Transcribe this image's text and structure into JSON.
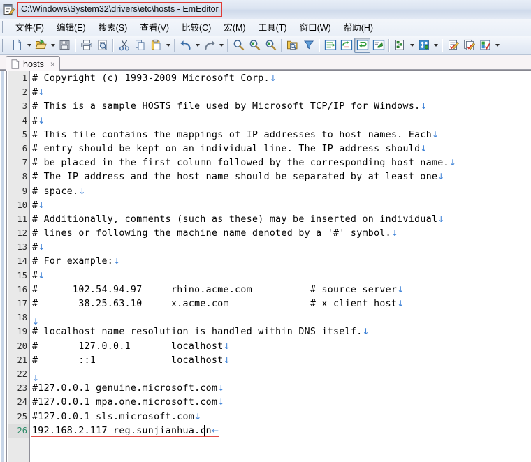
{
  "window": {
    "title": "C:\\Windows\\System32\\drivers\\etc\\hosts - EmEditor",
    "title_highlight_color": "#e03a34",
    "app_icon": "emeditor-document-pencil-icon"
  },
  "menu": {
    "items": [
      {
        "label": "文件(F)",
        "name": "menu-file"
      },
      {
        "label": "编辑(E)",
        "name": "menu-edit"
      },
      {
        "label": "搜索(S)",
        "name": "menu-search"
      },
      {
        "label": "查看(V)",
        "name": "menu-view"
      },
      {
        "label": "比较(C)",
        "name": "menu-compare"
      },
      {
        "label": "宏(M)",
        "name": "menu-macro"
      },
      {
        "label": "工具(T)",
        "name": "menu-tools"
      },
      {
        "label": "窗口(W)",
        "name": "menu-window"
      },
      {
        "label": "帮助(H)",
        "name": "menu-help"
      }
    ]
  },
  "toolbar": {
    "buttons": [
      "new-file-icon",
      "new-file-dropdown-icon",
      "open-file-icon",
      "open-file-dropdown-icon",
      "save-file-icon",
      "print-icon",
      "print-preview-icon",
      "cut-icon",
      "copy-icon",
      "paste-icon",
      "paste-dropdown-icon",
      "undo-icon",
      "undo-dropdown-icon",
      "redo-icon",
      "redo-dropdown-icon",
      "find-icon",
      "find-next-icon",
      "find-previous-icon",
      "find-in-files-icon",
      "filter-icon",
      "insert-line-icon",
      "replace-icon",
      "wrap-icon",
      "go-to-icon",
      "outline-icon",
      "outline-dropdown-icon",
      "snippet-icon",
      "snippet-dropdown-icon",
      "macro-icon",
      "macro-select-icon",
      "macro-properties-icon",
      "macro-dropdown-icon"
    ]
  },
  "tab": {
    "label": "hosts",
    "close_label": "×",
    "file_icon": "document-icon"
  },
  "editor": {
    "eol_marker": "↓",
    "eol_marker_cursor": "←",
    "current_line": 26,
    "highlight_border_color": "#e04a44",
    "current_line_number_color": "#2a8a66",
    "lines": [
      {
        "n": "1",
        "text": "# Copyright (c) 1993-2009 Microsoft Corp."
      },
      {
        "n": "2",
        "text": "#"
      },
      {
        "n": "3",
        "text": "# This is a sample HOSTS file used by Microsoft TCP/IP for Windows."
      },
      {
        "n": "4",
        "text": "#"
      },
      {
        "n": "5",
        "text": "# This file contains the mappings of IP addresses to host names. Each"
      },
      {
        "n": "6",
        "text": "# entry should be kept on an individual line. The IP address should"
      },
      {
        "n": "7",
        "text": "# be placed in the first column followed by the corresponding host name."
      },
      {
        "n": "8",
        "text": "# The IP address and the host name should be separated by at least one"
      },
      {
        "n": "9",
        "text": "# space."
      },
      {
        "n": "10",
        "text": "#"
      },
      {
        "n": "11",
        "text": "# Additionally, comments (such as these) may be inserted on individual"
      },
      {
        "n": "12",
        "text": "# lines or following the machine name denoted by a '#' symbol."
      },
      {
        "n": "13",
        "text": "#"
      },
      {
        "n": "14",
        "text": "# For example:"
      },
      {
        "n": "15",
        "text": "#"
      },
      {
        "n": "16",
        "text": "#      102.54.94.97     rhino.acme.com          # source server"
      },
      {
        "n": "17",
        "text": "#       38.25.63.10     x.acme.com              # x client host"
      },
      {
        "n": "18",
        "text": ""
      },
      {
        "n": "19",
        "text": "# localhost name resolution is handled within DNS itself."
      },
      {
        "n": "20",
        "text": "#       127.0.0.1       localhost"
      },
      {
        "n": "21",
        "text": "#       ::1             localhost"
      },
      {
        "n": "22",
        "text": ""
      },
      {
        "n": "23",
        "text": "#127.0.0.1 genuine.microsoft.com"
      },
      {
        "n": "24",
        "text": "#127.0.0.1 mpa.one.microsoft.com"
      },
      {
        "n": "25",
        "text": "#127.0.0.1 sls.microsoft.com"
      },
      {
        "n": "26",
        "text": "192.168.2.117 reg.sunjianhua.cn"
      }
    ]
  }
}
